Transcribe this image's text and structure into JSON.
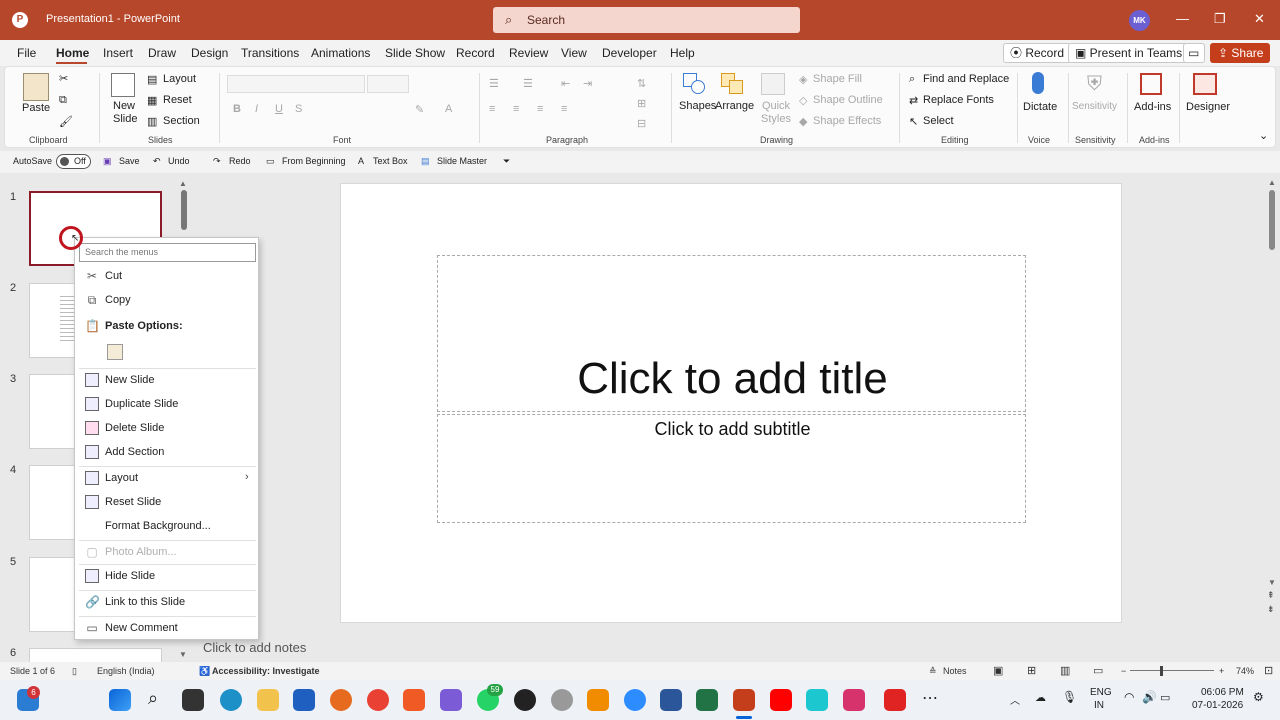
{
  "titlebar": {
    "app_title": "Presentation1  -  PowerPoint",
    "search_placeholder": "Search",
    "avatar": "MK"
  },
  "menu": {
    "tabs": [
      "File",
      "Home",
      "Insert",
      "Draw",
      "Design",
      "Transitions",
      "Animations",
      "Slide Show",
      "Record",
      "Review",
      "View",
      "Developer",
      "Help"
    ],
    "record_label": "Record",
    "teams_label": "Present in Teams",
    "share_label": "Share"
  },
  "ribbon": {
    "clipboard": {
      "paste": "Paste",
      "group": "Clipboard"
    },
    "slides": {
      "new_slide": "New Slide",
      "layout": "Layout",
      "reset": "Reset",
      "section": "Section",
      "group": "Slides"
    },
    "font": {
      "group": "Font"
    },
    "paragraph": {
      "group": "Paragraph"
    },
    "drawing": {
      "shapes": "Shapes",
      "arrange": "Arrange",
      "quick_styles": "Quick Styles",
      "shape_fill": "Shape Fill",
      "shape_outline": "Shape Outline",
      "shape_effects": "Shape Effects",
      "group": "Drawing"
    },
    "editing": {
      "find_replace": "Find and Replace",
      "replace_fonts": "Replace Fonts",
      "select": "Select",
      "group": "Editing"
    },
    "voice": {
      "dictate": "Dictate",
      "group": "Voice"
    },
    "sensitivity": {
      "label": "Sensitivity",
      "group": "Sensitivity"
    },
    "addins": {
      "label": "Add-ins",
      "group": "Add-ins"
    },
    "designer": {
      "label": "Designer"
    }
  },
  "qat": {
    "autosave": "AutoSave",
    "autosave_state": "Off",
    "save": "Save",
    "undo": "Undo",
    "redo": "Redo",
    "from_beginning": "From Beginning",
    "text_box": "Text Box",
    "slide_master": "Slide Master"
  },
  "thumbs": [
    "1",
    "2",
    "3",
    "4",
    "5",
    "6"
  ],
  "context_menu": {
    "search_placeholder": "Search the menus",
    "cut": "Cut",
    "copy": "Copy",
    "paste_options": "Paste Options:",
    "new_slide": "New Slide",
    "duplicate_slide": "Duplicate Slide",
    "delete_slide": "Delete Slide",
    "add_section": "Add Section",
    "layout": "Layout",
    "reset_slide": "Reset Slide",
    "format_background": "Format Background...",
    "photo_album": "Photo Album...",
    "hide_slide": "Hide Slide",
    "link_slide": "Link to this Slide",
    "new_comment": "New Comment"
  },
  "slide": {
    "title_placeholder": "Click to add title",
    "subtitle_placeholder": "Click to add subtitle",
    "notes_placeholder": "Click to add notes"
  },
  "status": {
    "slide_count": "Slide 1 of 6",
    "language": "English (India)",
    "accessibility": "Accessibility: Investigate",
    "notes": "Notes",
    "zoom": "74%"
  },
  "taskbar": {
    "badge_start": "6",
    "badge_whatsapp": "59",
    "lang1": "ENG",
    "lang2": "IN",
    "time": "06:06 PM",
    "date": "07-01-2026"
  },
  "colors": {
    "accent": "#b7472a",
    "share": "#c43e1c",
    "selection": "#8c1b2a"
  }
}
